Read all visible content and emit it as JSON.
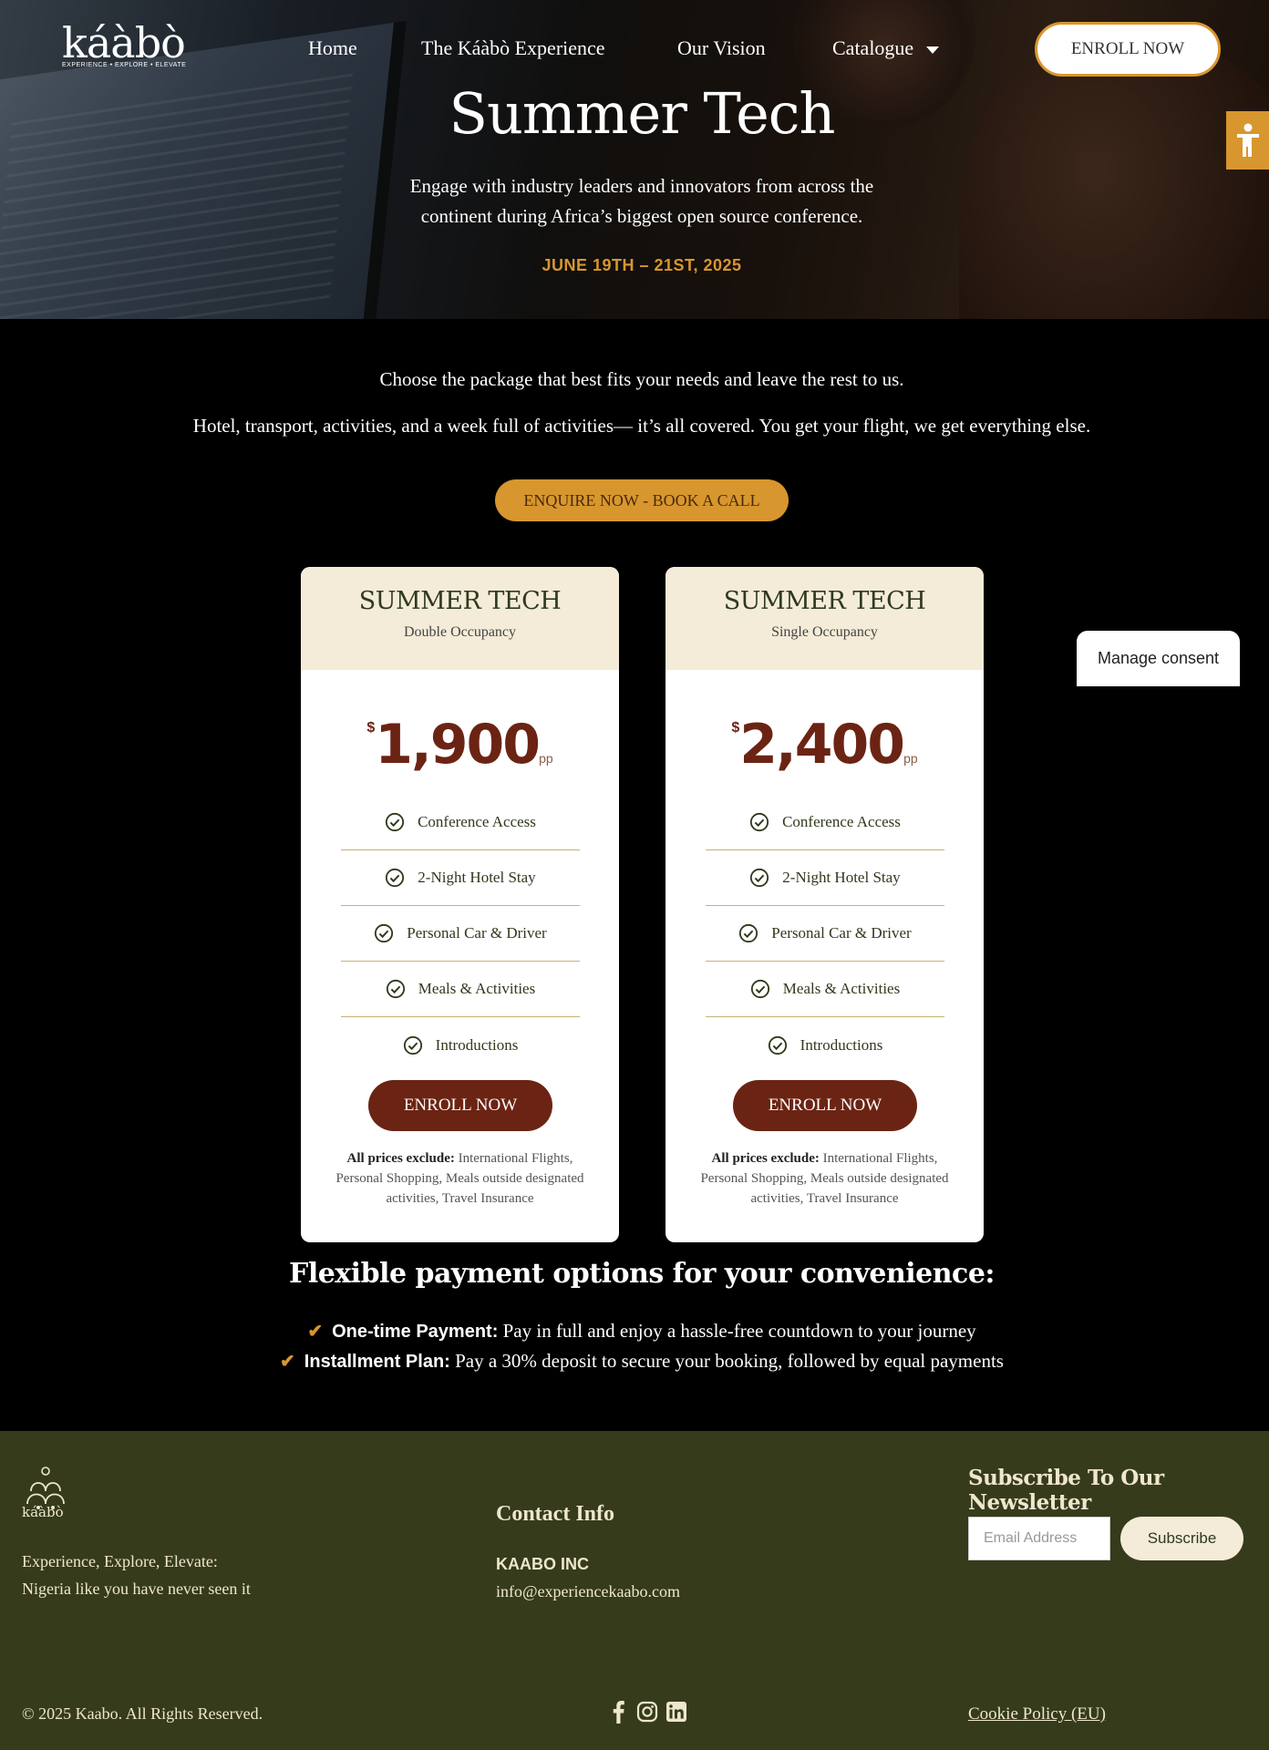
{
  "header": {
    "logo_text": "káàbò",
    "logo_tagline": "EXPERIENCE • EXPLORE • ELEVATE",
    "nav": [
      "Home",
      "The Káàbò Experience",
      "Our Vision",
      "Catalogue"
    ],
    "enroll_label": "ENROLL NOW"
  },
  "hero": {
    "title": "Summer Tech",
    "description_line1": "Engage with industry leaders and innovators from across the",
    "description_line2": "continent during Africa’s biggest open source conference.",
    "dates": "JUNE 19TH – 21ST, 2025"
  },
  "intro": {
    "line1": "Choose the package that best fits your needs and leave the rest to us.",
    "line2": "Hotel, transport, activities, and a week full of activities— it’s all covered. You get your flight, we get everything else.",
    "enquire_label": "ENQUIRE NOW - BOOK A CALL"
  },
  "packages": [
    {
      "title": "SUMMER TECH",
      "subtitle": "Double Occupancy",
      "currency": "$",
      "price": "1,900",
      "unit": "pp",
      "features": [
        "Conference Access",
        "2-Night Hotel Stay",
        "Personal Car & Driver",
        "Meals & Activities",
        "Introductions"
      ],
      "enroll_label": "ENROLL NOW",
      "exclusions_label": "All prices exclude:",
      "exclusions": "International Flights, Personal Shopping, Meals outside designated activities, Travel Insurance"
    },
    {
      "title": "SUMMER TECH",
      "subtitle": "Single Occupancy",
      "currency": "$",
      "price": "2,400",
      "unit": "pp",
      "features": [
        "Conference Access",
        "2-Night Hotel Stay",
        "Personal Car & Driver",
        "Meals & Activities",
        "Introductions"
      ],
      "enroll_label": "ENROLL NOW",
      "exclusions_label": "All prices exclude:",
      "exclusions": "International Flights, Personal Shopping, Meals outside designated activities, Travel Insurance"
    }
  ],
  "consent_label": "Manage consent",
  "payment": {
    "title": "Flexible payment options for your convenience:",
    "options": [
      {
        "label": "One-time Payment:",
        "text": "Pay in full and enjoy a hassle-free countdown to your journey"
      },
      {
        "label": "Installment Plan:",
        "text": "Pay a 30% deposit to secure your booking, followed by equal payments"
      }
    ]
  },
  "footer": {
    "logo_text": "káàbò",
    "tagline_line1": "Experience, Explore, Elevate:",
    "tagline_line2": "Nigeria like you have never seen it",
    "contact_title": "Contact Info",
    "company": "KAABO INC",
    "email": "info@experiencekaabo.com",
    "newsletter_title": "Subscribe To Our Newsletter",
    "email_placeholder": "Email Address",
    "subscribe_label": "Subscribe",
    "copyright": "© 2025 Kaabo. All Rights Reserved.",
    "social_icons": [
      "facebook-icon",
      "instagram-icon",
      "linkedin-icon"
    ],
    "cookie_label": "Cookie Policy (EU)"
  },
  "colors": {
    "accent": "#d8962e",
    "maroon": "#6b2413",
    "olive": "#363b1c",
    "cream": "#f4ecd8"
  }
}
